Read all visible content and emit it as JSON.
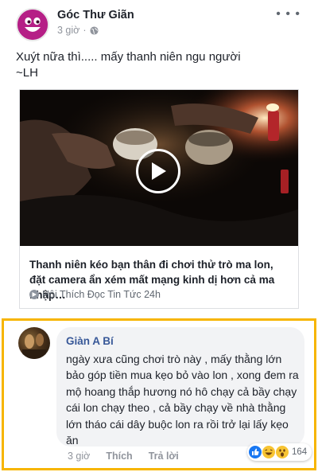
{
  "post": {
    "page_name": "Góc Thư Giãn",
    "time": "3 giờ",
    "privacy_icon": "globe-icon",
    "more_icon": "more-options-icon",
    "text_line1": "Xuýt nữa thì..... mấy thanh niên ngu người",
    "text_line2": "~LH"
  },
  "link": {
    "play_icon": "play-icon",
    "title": "Thanh niên kéo bạn thân đi chơi thử trò ma lon, đặt camera ẩn xém mất mạng kinh dị hơn cả ma nhập…",
    "source": "Hội Thích Đọc Tin Tức 24h",
    "source_icon": "page-source-icon"
  },
  "comment": {
    "author": "Giàn A Bí",
    "text": "ngày xưa cũng chơi trò này , mấy thằng lớn bảo góp tiền mua kẹo bỏ vào lon , xong đem ra mộ hoang thắp hương nó hô chạy cả bầy chạy cái lon chạy theo , cả bầy chạy về nhà thằng lớn tháo cái dây buộc lon ra rồi trở lại lấy kẹo ăn",
    "time": "3 giờ",
    "like_label": "Thích",
    "reply_label": "Trả lời",
    "reactions": [
      "like",
      "haha",
      "wow"
    ],
    "reaction_count": "164",
    "highlight_color": "#f7b500"
  },
  "colors": {
    "name_link": "#385898",
    "meta_gray": "#90949c",
    "bubble_bg": "#f2f3f5"
  }
}
